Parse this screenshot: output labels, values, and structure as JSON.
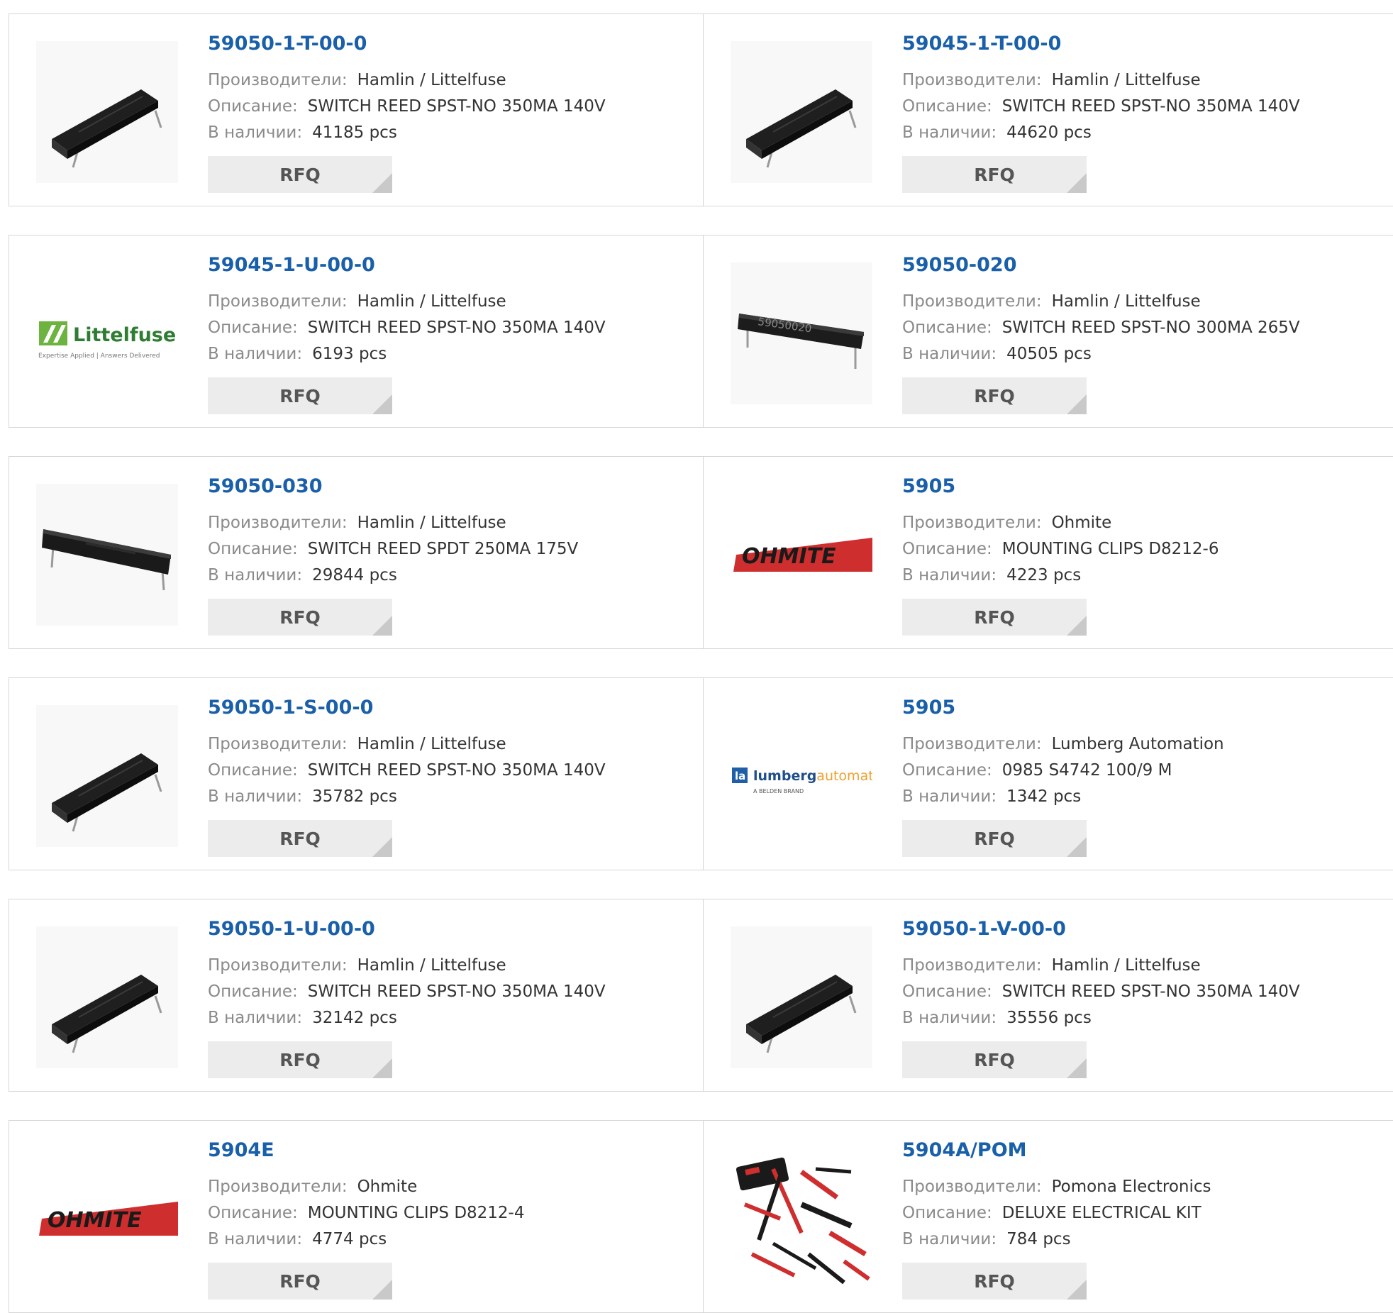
{
  "labels": {
    "manufacturer": "Производители:",
    "description": "Описание:",
    "stock": "В наличии:",
    "rfq": "RFQ"
  },
  "brands": {
    "littelfuse": {
      "name": "Littelfuse",
      "tagline": "Expertise Applied | Answers Delivered"
    },
    "ohmite": {
      "name": "OHMITE"
    },
    "lumberg": {
      "name_bold": "lumberg",
      "name_light": "automation",
      "sub": "A BELDEN BRAND"
    },
    "reed_marking": "59050020"
  },
  "products": [
    {
      "part": "59050-1-T-00-0",
      "manufacturer": "Hamlin / Littelfuse",
      "description": "SWITCH REED SPST-NO 350MA 140V",
      "stock": "41185 pcs",
      "image": "reed-switch"
    },
    {
      "part": "59045-1-T-00-0",
      "manufacturer": "Hamlin / Littelfuse",
      "description": "SWITCH REED SPST-NO 350MA 140V",
      "stock": "44620 pcs",
      "image": "reed-switch"
    },
    {
      "part": "59045-1-U-00-0",
      "manufacturer": "Hamlin / Littelfuse",
      "description": "SWITCH REED SPST-NO 350MA 140V",
      "stock": "6193 pcs",
      "image": "littelfuse-logo"
    },
    {
      "part": "59050-020",
      "manufacturer": "Hamlin / Littelfuse",
      "description": "SWITCH REED SPST-NO 300MA 265V",
      "stock": "40505 pcs",
      "image": "reed-switch-marked"
    },
    {
      "part": "59050-030",
      "manufacturer": "Hamlin / Littelfuse",
      "description": "SWITCH REED SPDT 250MA 175V",
      "stock": "29844 pcs",
      "image": "reed-switch-flat"
    },
    {
      "part": "5905",
      "manufacturer": "Ohmite",
      "description": "MOUNTING CLIPS D8212-6",
      "stock": "4223 pcs",
      "image": "ohmite-logo"
    },
    {
      "part": "59050-1-S-00-0",
      "manufacturer": "Hamlin / Littelfuse",
      "description": "SWITCH REED SPST-NO 350MA 140V",
      "stock": "35782 pcs",
      "image": "reed-switch"
    },
    {
      "part": "5905",
      "manufacturer": "Lumberg Automation",
      "description": "0985 S4742 100/9 M",
      "stock": "1342 pcs",
      "image": "lumberg-logo"
    },
    {
      "part": "59050-1-U-00-0",
      "manufacturer": "Hamlin / Littelfuse",
      "description": "SWITCH REED SPST-NO 350MA 140V",
      "stock": "32142 pcs",
      "image": "reed-switch"
    },
    {
      "part": "59050-1-V-00-0",
      "manufacturer": "Hamlin / Littelfuse",
      "description": "SWITCH REED SPST-NO 350MA 140V",
      "stock": "35556 pcs",
      "image": "reed-switch"
    },
    {
      "part": "5904E",
      "manufacturer": "Ohmite",
      "description": "MOUNTING CLIPS D8212-4",
      "stock": "4774 pcs",
      "image": "ohmite-logo"
    },
    {
      "part": "5904A/POM",
      "manufacturer": "Pomona Electronics",
      "description": "DELUXE ELECTRICAL KIT",
      "stock": "784 pcs",
      "image": "test-lead-kit"
    }
  ]
}
